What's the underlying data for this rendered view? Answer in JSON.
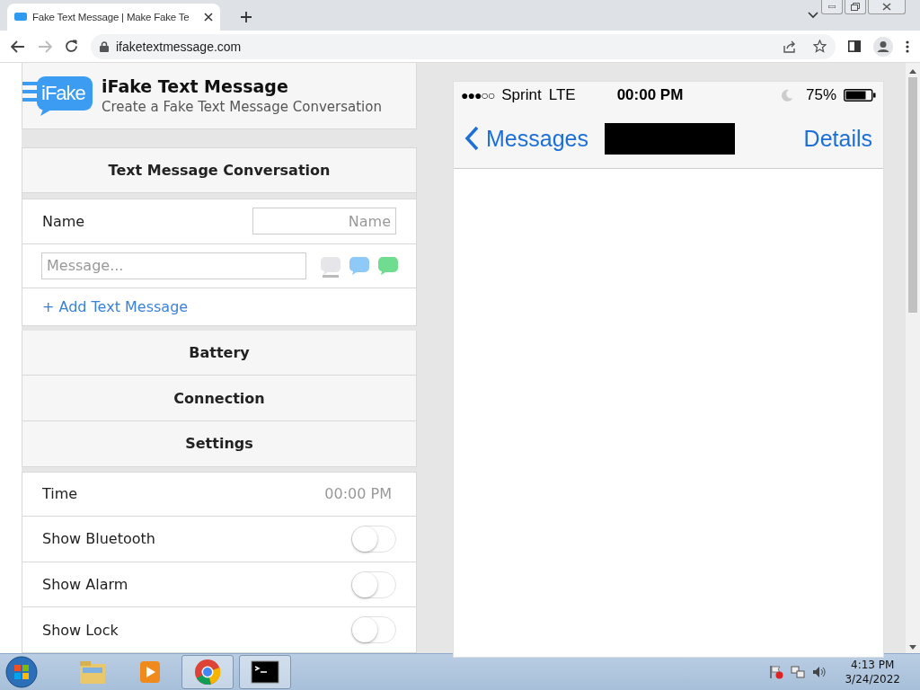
{
  "browser": {
    "tab_title": "Fake Text Message | Make Fake Te",
    "url": "ifaketextmessage.com"
  },
  "header": {
    "logo_text": "iFake",
    "title": "iFake Text Message",
    "subtitle": "Create a Fake Text Message Conversation"
  },
  "conversation": {
    "heading": "Text Message Conversation",
    "name_label": "Name",
    "name_placeholder": "Name",
    "message_placeholder": "Message...",
    "add_link": "+ Add Text Message",
    "bubbles": [
      {
        "color": "#e5e5ea",
        "selected": true
      },
      {
        "color": "#8ec9f8",
        "selected": false
      },
      {
        "color": "#6fdc8f",
        "selected": false
      }
    ]
  },
  "sections": [
    {
      "title": "Battery"
    },
    {
      "title": "Connection"
    },
    {
      "title": "Settings"
    }
  ],
  "settings": [
    {
      "kind": "time",
      "label": "Time",
      "value": "00:00 PM"
    },
    {
      "kind": "toggle",
      "label": "Show Bluetooth",
      "on": false
    },
    {
      "kind": "toggle",
      "label": "Show Alarm",
      "on": false
    },
    {
      "kind": "toggle",
      "label": "Show Lock",
      "on": false
    }
  ],
  "phone": {
    "signal": "●●●○○",
    "carrier": "Sprint",
    "network": "LTE",
    "time": "00:00 PM",
    "battery": "75%",
    "back": "Messages",
    "details": "Details"
  },
  "taskbar": {
    "time": "4:13 PM",
    "date": "3/24/2022"
  }
}
